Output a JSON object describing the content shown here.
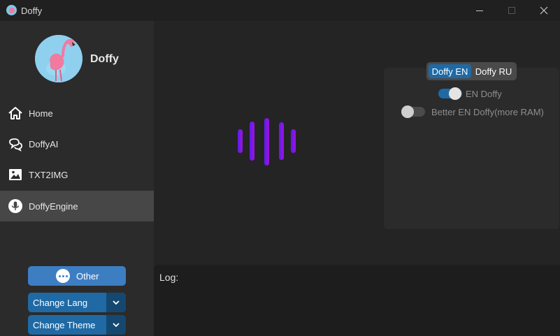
{
  "window": {
    "title": "Doffy"
  },
  "sidebar": {
    "brand": "Doffy",
    "items": [
      {
        "label": "Home",
        "icon": "home-icon"
      },
      {
        "label": "DoffyAI",
        "icon": "chat-bubbles-icon"
      },
      {
        "label": "TXT2IMG",
        "icon": "image-icon"
      },
      {
        "label": "DoffyEngine",
        "icon": "microphone-icon",
        "active": true
      }
    ],
    "other_label": "Other",
    "change_lang_label": "Change Lang",
    "change_theme_label": "Change Theme"
  },
  "engine": {
    "segments": [
      "Doffy EN",
      "Doffy RU"
    ],
    "selected_segment": "Doffy EN",
    "switch_en_label": "EN Doffy",
    "switch_en_on": true,
    "switch_better_label": "Better EN Doffy(more RAM)",
    "switch_better_on": false
  },
  "log": {
    "label": "Log:"
  },
  "colors": {
    "accent": "#1f6aa5",
    "accent_light": "#3d7ec3",
    "wave_start": "#5a1ee8",
    "wave_end": "#a011e0"
  }
}
